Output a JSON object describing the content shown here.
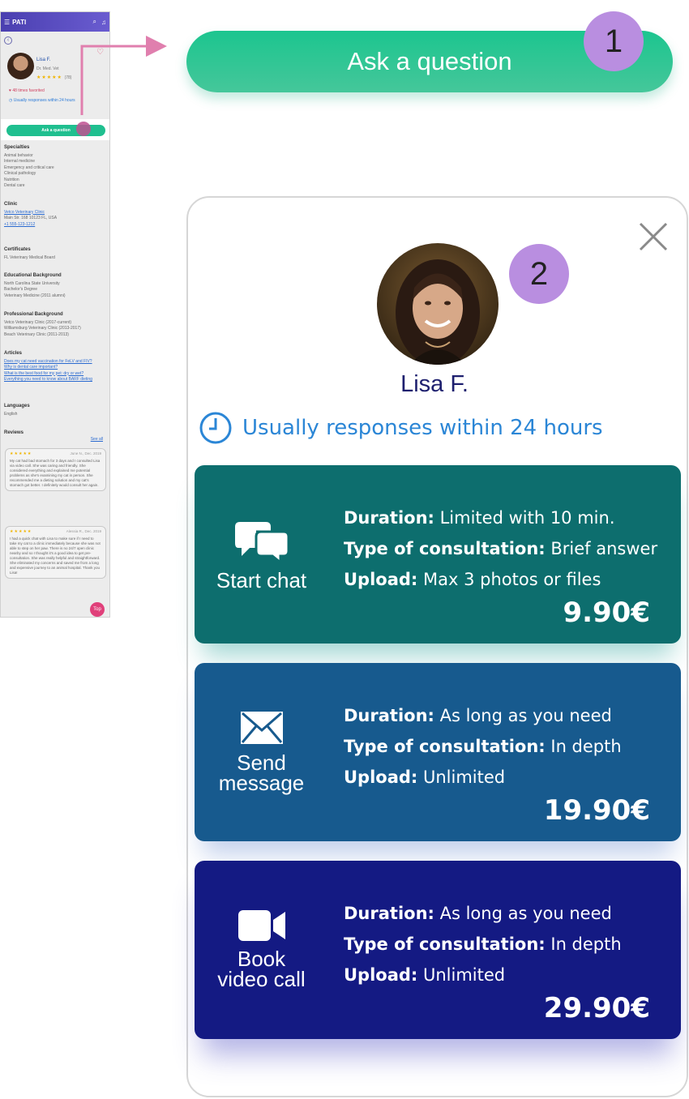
{
  "phone": {
    "brand": "PATI",
    "vet_name": "Lisa F.",
    "vet_title": "Dr. Med. Vet",
    "rating_count": "(78)",
    "favorited": "48 times favorited",
    "response_time": "Usually responses within 24 hours",
    "ask_button": "Ask a question",
    "specialties_title": "Specialties",
    "specialties": [
      "Animal behavior",
      "Internal medicine",
      "Emergency and critical care",
      "Clinical pathology",
      "Nutrition",
      "Dental care"
    ],
    "clinic_title": "Clinic",
    "clinic_name": "Vetco Veterinary Clinic",
    "clinic_address": "Main Str. 168 10123 FL, USA",
    "clinic_phone": "+1 555-123-1212",
    "certificates_title": "Certificates",
    "certificates": [
      "FL Veterinary Medical Board"
    ],
    "education_title": "Educational Background",
    "education": [
      "North Carolina State University",
      "Bachelor's Degree",
      "Veterinary Medicine (2011 alumni)"
    ],
    "professional_title": "Professional Background",
    "professional": [
      "Vetco Veterinary Clinic (2017-current)",
      "Williamsburg Veterinary Clinic (2013-2017)",
      "Beach Veterinary Clinic (2011-2013)"
    ],
    "articles_title": "Articles",
    "articles": [
      "Does my cat need vaccination for FeLV and FIV?",
      "Why is dental care important?",
      "What is the best food for my pet: dry or wet?",
      "Everything you need to know about BARF dieting"
    ],
    "languages_title": "Languages",
    "languages": [
      "English"
    ],
    "reviews_title": "Reviews",
    "see_all": "See all",
    "reviews": [
      {
        "author": "June N., Dec. 2019",
        "text": "My cat had bad stomach for 3 days and I consulted Lisa via video call. She was caring and friendly. She considered everything and explained me potential problems as she's examining my cat in person. She recommended me a dieting solution and my cat's stomach got better. I definitely would consult her again."
      },
      {
        "author": "Alessia R., Dec. 2019",
        "text": "I had a quick chat with Lisa to make sure if I need to take my cat to a clinic immediately because she was not able to step on her paw. There is no 24/7 open clinic nearby and so I thought it's a good idea to get pre-consultation. She was really helpful and straightforward. She eliminated my concerns and saved me from a long and expensive journey to an animal hospital. Thank you Lisa!"
      }
    ],
    "fab_label": "Top"
  },
  "ask_button": {
    "label": "Ask a question"
  },
  "markers": {
    "one": "1",
    "two": "2"
  },
  "modal": {
    "vet_name": "Lisa F.",
    "response_time": "Usually responses within 24 hours",
    "options": [
      {
        "icon": "chat-bubbles-icon",
        "label": "Start chat",
        "duration_label": "Duration:",
        "duration": "Limited with 10 min.",
        "type_label": "Type of consultation:",
        "type": "Brief answer",
        "upload_label": "Upload:",
        "upload": "Max 3 photos or files",
        "price": "9.90€"
      },
      {
        "icon": "envelope-icon",
        "label": "Send\nmessage",
        "duration_label": "Duration:",
        "duration": "As long as you need",
        "type_label": "Type of consultation:",
        "type": "In depth",
        "upload_label": "Upload:",
        "upload": "Unlimited",
        "price": "19.90€"
      },
      {
        "icon": "video-camera-icon",
        "label": "Book\nvideo call",
        "duration_label": "Duration:",
        "duration": "As long as you need",
        "type_label": "Type of consultation:",
        "type": "In depth",
        "upload_label": "Upload:",
        "upload": "Unlimited",
        "price": "29.90€"
      }
    ]
  },
  "colors": {
    "ask_green": "#1cc58f",
    "chat_card": "#0d6e6e",
    "message_card": "#175a8e",
    "video_card": "#141a83",
    "name_navy": "#1d1f6e",
    "response_blue": "#2b86d6",
    "marker_purple": "#b98ee0",
    "connector_pink": "#e07fae"
  }
}
